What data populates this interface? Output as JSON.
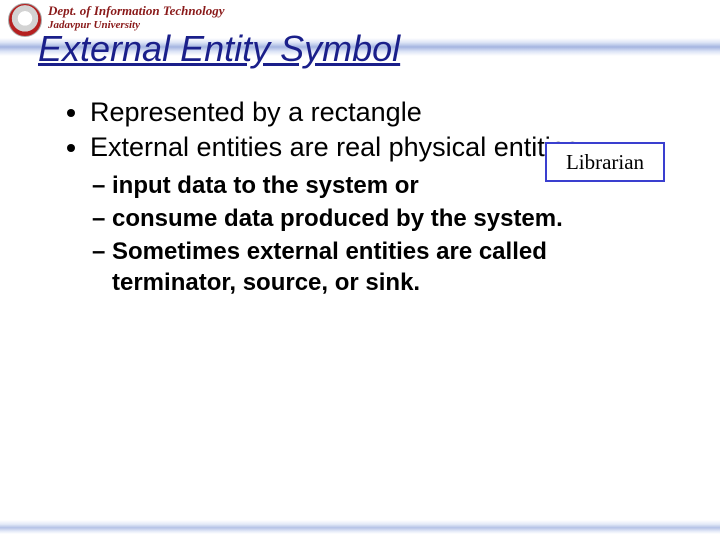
{
  "header": {
    "dept_line1": "Dept. of Information Technology",
    "dept_line2": "Jadavpur University"
  },
  "title": "External Entity Symbol",
  "bullets": [
    "Represented by a rectangle",
    "External entities are real physical entities:"
  ],
  "sub_bullets": [
    "input data to the system or",
    "consume data produced by the system.",
    "Sometimes external entities are called terminator, source, or sink."
  ],
  "entity_box_label": "Librarian"
}
